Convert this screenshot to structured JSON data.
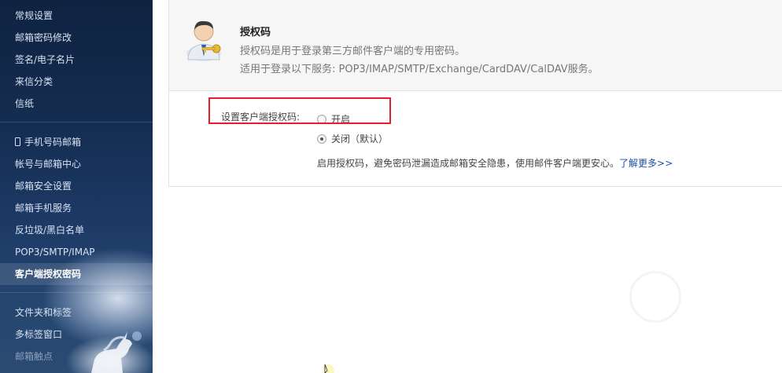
{
  "sidebar": {
    "items": [
      {
        "label": "常规设置"
      },
      {
        "label": "邮箱密码修改"
      },
      {
        "label": "签名/电子名片"
      },
      {
        "label": "来信分类"
      },
      {
        "label": "信纸"
      },
      {
        "label": "手机号码邮箱",
        "icon": "phone-icon"
      },
      {
        "label": "帐号与邮箱中心"
      },
      {
        "label": "邮箱安全设置"
      },
      {
        "label": "邮箱手机服务"
      },
      {
        "label": "反垃圾/黑白名单"
      },
      {
        "label": "POP3/SMTP/IMAP"
      },
      {
        "label": "客户端授权密码",
        "active": true
      },
      {
        "label": "文件夹和标签"
      },
      {
        "label": "多标签窗口"
      },
      {
        "label": "邮箱触点"
      }
    ]
  },
  "header": {
    "title": "授权码",
    "desc1": "授权码是用于登录第三方邮件客户端的专用密码。",
    "desc2": "适用于登录以下服务: POP3/IMAP/SMTP/Exchange/CardDAV/CalDAV服务。"
  },
  "form": {
    "label": "设置客户端授权码:",
    "options": [
      {
        "label": "开启",
        "checked": false
      },
      {
        "label": "关闭（默认）",
        "checked": true
      }
    ],
    "note": "启用授权码，避免密码泄漏造成邮箱安全隐患，使用邮件客户端更安心。",
    "link": "了解更多>>"
  },
  "colors": {
    "highlight": "#e0202a",
    "link": "#1a4fa0",
    "sidebar_bg": "#152d52"
  }
}
